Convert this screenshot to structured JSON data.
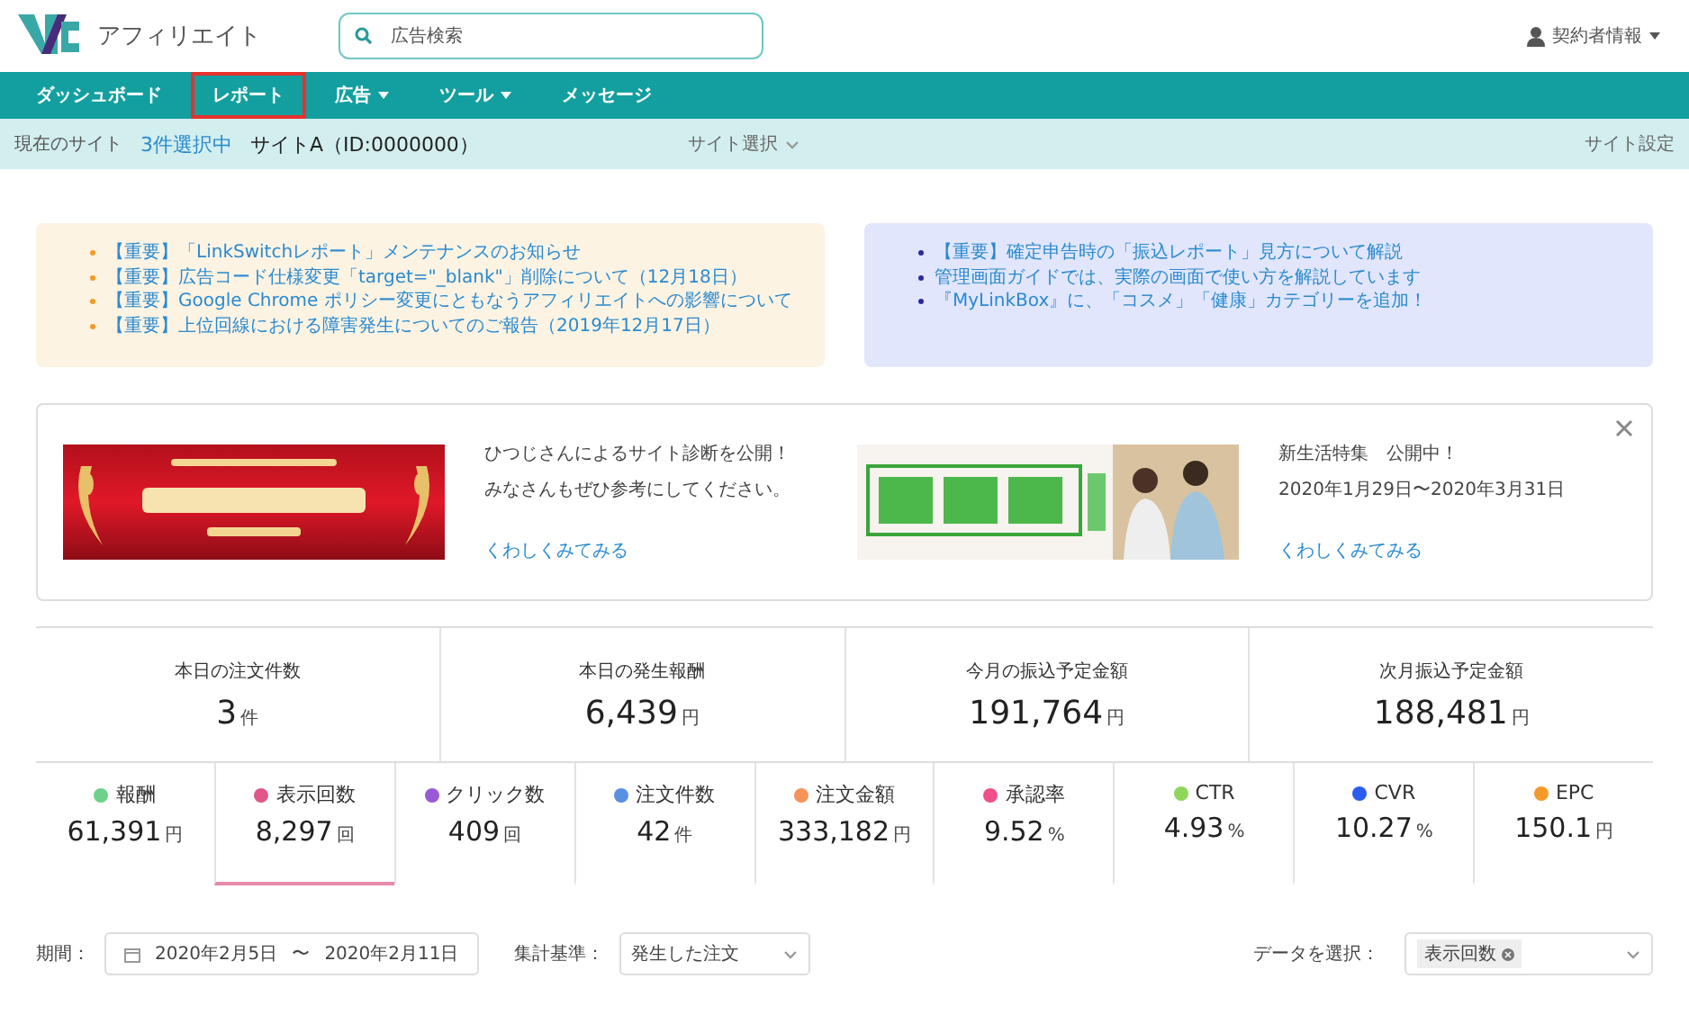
{
  "header": {
    "brand": "アフィリエイト",
    "search": {
      "placeholder": "広告検索"
    },
    "account": "契約者情報"
  },
  "nav": [
    {
      "label": "ダッシュボード",
      "selected": false,
      "dropdown": false
    },
    {
      "label": "レポート",
      "selected": true,
      "dropdown": false
    },
    {
      "label": "広告",
      "selected": false,
      "dropdown": true
    },
    {
      "label": "ツール",
      "selected": false,
      "dropdown": true
    },
    {
      "label": "メッセージ",
      "selected": false,
      "dropdown": false
    }
  ],
  "site_bar": {
    "label": "現在のサイト",
    "count": "3件選択中",
    "site": "サイトA（ID:0000000）",
    "select": "サイト選択",
    "settings": "サイト設定"
  },
  "notices": [
    {
      "kind": "warning",
      "items": [
        "【重要】「LinkSwitchレポート」メンテナンスのお知らせ",
        "【重要】広告コード仕様変更「target=\"_blank\"」削除について（12月18日）",
        "【重要】Google Chrome ポリシー変更にともなうアフィリエイトへの影響について",
        "【重要】上位回線における障害発生についてのご報告（2019年12月17日）"
      ]
    },
    {
      "kind": "info",
      "items": [
        "【重要】確定申告時の「振込レポート」見方について解説",
        "管理画面ガイドでは、実際の画面で使い方を解説しています",
        "『MyLinkBox』に、「コスメ」「健康」カテゴリーを追加！"
      ]
    }
  ],
  "promos": [
    {
      "kind": "award",
      "lines": [
        "ひつじさんによるサイト診断を公開！",
        "みなさんもぜひ参考にしてください。"
      ],
      "link": "くわしくみてみる"
    },
    {
      "kind": "lifestyle",
      "lines": [
        "新生活特集　公開中！",
        "2020年1月29日〜2020年3月31日"
      ],
      "link": "くわしくみてみる"
    }
  ],
  "summary": [
    {
      "label": "本日の注文件数",
      "value": "3",
      "unit": "件"
    },
    {
      "label": "本日の発生報酬",
      "value": "6,439",
      "unit": "円"
    },
    {
      "label": "今月の振込予定金額",
      "value": "191,764",
      "unit": "円"
    },
    {
      "label": "次月振込予定金額",
      "value": "188,481",
      "unit": "円"
    }
  ],
  "metrics": [
    {
      "label": "報酬",
      "value": "61,391",
      "unit": "円",
      "color": "#6fd08c",
      "selected": false
    },
    {
      "label": "表示回数",
      "value": "8,297",
      "unit": "回",
      "color": "#e0588a",
      "selected": true
    },
    {
      "label": "クリック数",
      "value": "409",
      "unit": "回",
      "color": "#9a5ad6",
      "selected": false
    },
    {
      "label": "注文件数",
      "value": "42",
      "unit": "件",
      "color": "#5b8fe0",
      "selected": false
    },
    {
      "label": "注文金額",
      "value": "333,182",
      "unit": "円",
      "color": "#f5935a",
      "selected": false
    },
    {
      "label": "承認率",
      "value": "9.52",
      "unit": "%",
      "color": "#f0508a",
      "selected": false
    },
    {
      "label": "CTR",
      "value": "4.93",
      "unit": "%",
      "color": "#8fd65a",
      "selected": false
    },
    {
      "label": "CVR",
      "value": "10.27",
      "unit": "%",
      "color": "#2a5cf0",
      "selected": false
    },
    {
      "label": "EPC",
      "value": "150.1",
      "unit": "円",
      "color": "#f59a2a",
      "selected": false
    }
  ],
  "filters": {
    "period_label": "期間：",
    "date_from": "2020年2月5日",
    "date_sep": "〜",
    "date_to": "2020年2月11日",
    "basis_label": "集計基準：",
    "basis": "発生した注文",
    "data_label": "データを選択：",
    "data_tag": "表示回数"
  }
}
